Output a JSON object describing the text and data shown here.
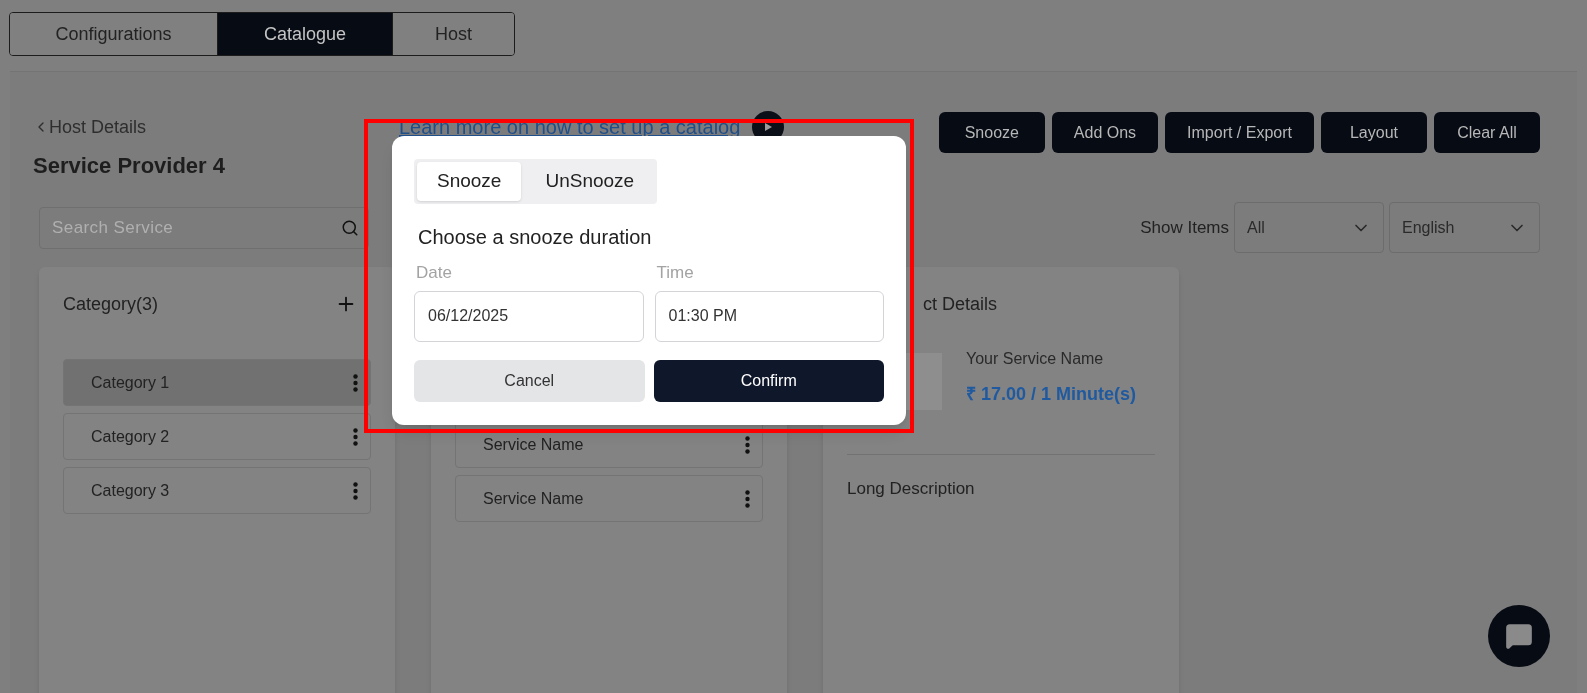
{
  "top_tabs": [
    {
      "label": "Configurations",
      "selected": false
    },
    {
      "label": "Catalogue",
      "selected": true
    },
    {
      "label": "Host",
      "selected": false
    }
  ],
  "back_link": "Host Details",
  "title": "Service Provider 4",
  "learn_link": "Learn more on how to set up a catalog",
  "actions": [
    "Snooze",
    "Add Ons",
    "Import / Export",
    "Layout",
    "Clear All"
  ],
  "search": {
    "placeholder": "Search Service"
  },
  "show_items": {
    "label": "Show Items",
    "filter": "All",
    "language": "English"
  },
  "categories": {
    "title": "Category(3)",
    "items": [
      {
        "label": "Category 1",
        "selected": true
      },
      {
        "label": "Category 2",
        "selected": false
      },
      {
        "label": "Category 3",
        "selected": false
      }
    ]
  },
  "services": [
    "Service Name",
    "Service Name"
  ],
  "details": {
    "title_fragment": "ct Details",
    "service_name": "Your Service Name",
    "price": "₹ 17.00 / 1 Minute(s)",
    "long_description": "Long Description"
  },
  "modal": {
    "tabs": [
      {
        "label": "Snooze",
        "selected": true
      },
      {
        "label": "UnSnooze",
        "selected": false
      }
    ],
    "heading": "Choose a snooze duration",
    "date": {
      "label": "Date",
      "value": "06/12/2025"
    },
    "time": {
      "label": "Time",
      "value": "01:30 PM"
    },
    "cancel": "Cancel",
    "confirm": "Confirm"
  }
}
